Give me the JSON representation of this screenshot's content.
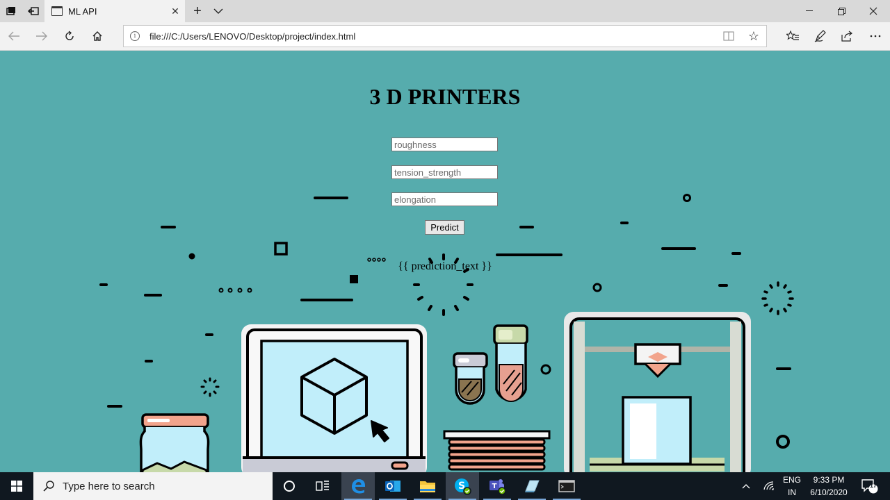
{
  "browser": {
    "tab_title": "ML API",
    "url": "file:///C:/Users/LENOVO/Desktop/project/index.html"
  },
  "page": {
    "title": "3 D PRINTERS",
    "fields": {
      "roughness_placeholder": "roughness",
      "tension_placeholder": "tension_strength",
      "elongation_placeholder": "elongation"
    },
    "predict_label": "Predict",
    "prediction_text": "{{ prediction_text }}",
    "colors": {
      "background": "#56acad",
      "screen_fill": "#c1eefa",
      "accent_salmon": "#f2a48c",
      "outline": "#000000"
    }
  },
  "taskbar": {
    "search_placeholder": "Type here to search",
    "language_top": "ENG",
    "language_bottom": "IN",
    "time": "9:33 PM",
    "date": "6/10/2020",
    "notification_count": "17"
  }
}
